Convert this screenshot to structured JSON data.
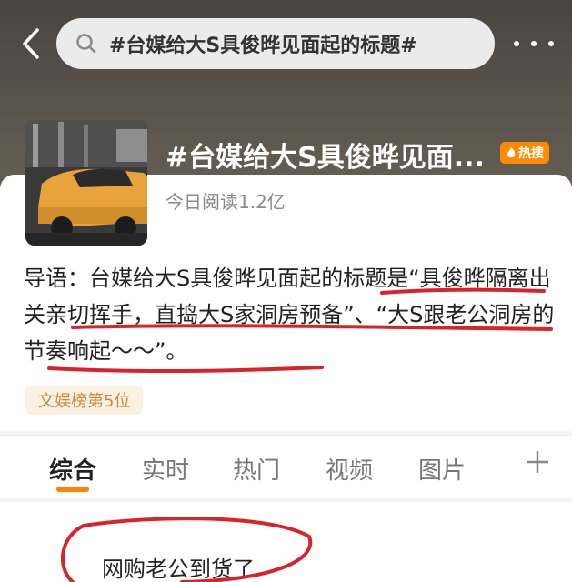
{
  "search": {
    "query": "#台媒给大S具俊晔见面起的标题#"
  },
  "topic": {
    "title": "#台媒给大S具俊晔见面...",
    "badge": "热搜",
    "reads": "今日阅读1.2亿",
    "intro": "导语：台媒给大S具俊晔见面起的标题是“具俊晔隔离出关亲切挥手，直捣大S家洞房预备”、“大S跟老公洞房的节奏响起～～”。",
    "rank": "文娱榜第5位"
  },
  "tabs": [
    "综合",
    "实时",
    "热门",
    "视频",
    "图片"
  ],
  "feed": {
    "first_post": "网购老公到货了"
  },
  "colors": {
    "accent": "#ff8200",
    "annotation": "#d9232b",
    "badge": "#ff8a00"
  }
}
